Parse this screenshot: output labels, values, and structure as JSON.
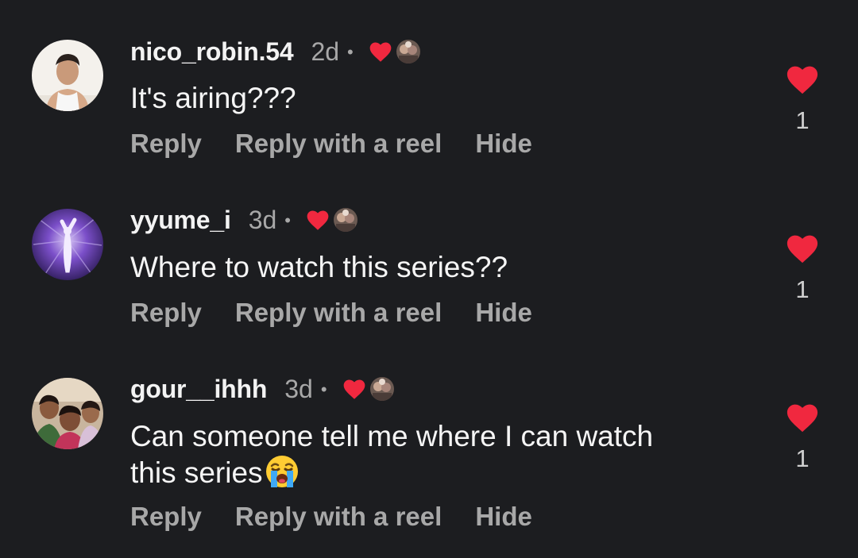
{
  "colors": {
    "background": "#1c1d20",
    "heart": "#f0283f",
    "secondary_text": "#a8a8a8",
    "primary_text": "#f5f5f5"
  },
  "comments": [
    {
      "username": "nico_robin.54",
      "time": "2d",
      "separator": "•",
      "text": "It's airing???",
      "liked_by_creator": true,
      "actions": {
        "reply": "Reply",
        "reply_reel": "Reply with a reel",
        "hide": "Hide"
      },
      "like_count": "1",
      "liked": true
    },
    {
      "username": "yyume_i",
      "time": "3d",
      "separator": "•",
      "text": "Where to watch this series??",
      "liked_by_creator": true,
      "actions": {
        "reply": "Reply",
        "reply_reel": "Reply with a reel",
        "hide": "Hide"
      },
      "like_count": "1",
      "liked": true
    },
    {
      "username": "gour__ihhh",
      "time": "3d",
      "separator": "•",
      "text_line1": "Can someone tell me where I can watch",
      "text_line2": "this series",
      "emoji": "loudly-crying-face-emoji",
      "liked_by_creator": true,
      "actions": {
        "reply": "Reply",
        "reply_reel": "Reply with a reel",
        "hide": "Hide"
      },
      "like_count": "1",
      "liked": true
    }
  ]
}
